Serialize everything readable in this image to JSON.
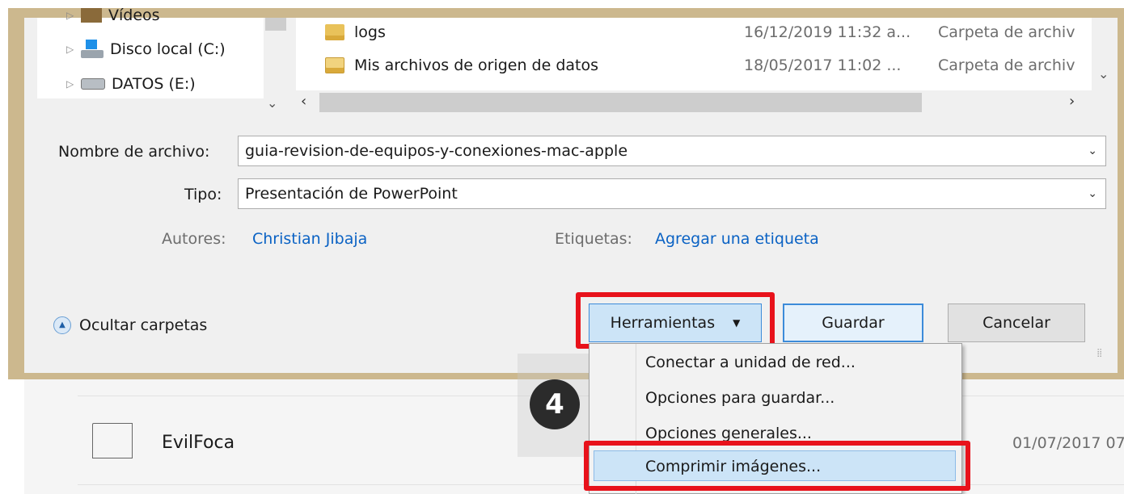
{
  "nav": {
    "items": [
      {
        "label": "Vídeos",
        "icon": "videos-folder-icon"
      },
      {
        "label": "Disco local (C:)",
        "icon": "windows-drive-icon"
      },
      {
        "label": "DATOS (E:)",
        "icon": "drive-icon"
      }
    ]
  },
  "files": [
    {
      "name": "logs",
      "date": "16/12/2019 11:32 a...",
      "type": "Carpeta de archiv"
    },
    {
      "name": "Mis archivos de origen de datos",
      "date": "18/05/2017 11:02 ...",
      "type": "Carpeta de archiv"
    }
  ],
  "form": {
    "filename_label": "Nombre de archivo:",
    "filename_value": "guia-revision-de-equipos-y-conexiones-mac-apple",
    "type_label": "Tipo:",
    "type_value": "Presentación de PowerPoint",
    "authors_label": "Autores:",
    "authors_value": "Christian Jibaja",
    "tags_label": "Etiquetas:",
    "tags_value": "Agregar una etiqueta"
  },
  "footer": {
    "hide_folders": "Ocultar carpetas",
    "tools": "Herramientas",
    "save": "Guardar",
    "cancel": "Cancelar"
  },
  "menu": {
    "items": [
      "Conectar a unidad de red...",
      "Opciones para guardar...",
      "Opciones generales...",
      "Comprimir imágenes..."
    ],
    "highlighted_index": 3
  },
  "annotation": {
    "step": "4",
    "highlight_color": "#e8121b"
  },
  "background": {
    "folder_name": "EvilFoca",
    "folder_date": "01/07/2017 07"
  },
  "colors": {
    "link": "#0a62c4",
    "accent": "#3c8bd9",
    "frame": "#ccb88e"
  }
}
